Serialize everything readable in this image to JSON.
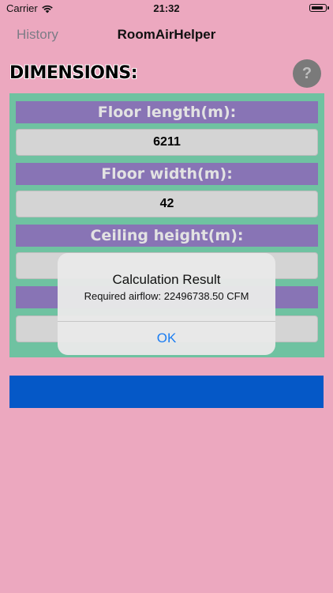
{
  "status_bar": {
    "carrier": "Carrier",
    "time": "21:32"
  },
  "nav": {
    "back_label": "History",
    "title": "RoomAirHelper"
  },
  "section": {
    "title": "DIMENSIONS:",
    "help_label": "?"
  },
  "fields": [
    {
      "label": "Floor length(m):",
      "value": "6211"
    },
    {
      "label": "Floor width(m):",
      "value": "42"
    },
    {
      "label": "Ceiling height(m):",
      "value": ""
    },
    {
      "label": "",
      "value": ""
    }
  ],
  "alert": {
    "title": "Calculation Result",
    "message": "Required airflow: 22496738.50 CFM",
    "ok_label": "OK"
  },
  "colors": {
    "background": "#eca8bf",
    "panel": "#6fc2a1",
    "label_bar": "#8874b5",
    "button_bar": "#0558c7",
    "accent": "#1a7df2"
  }
}
